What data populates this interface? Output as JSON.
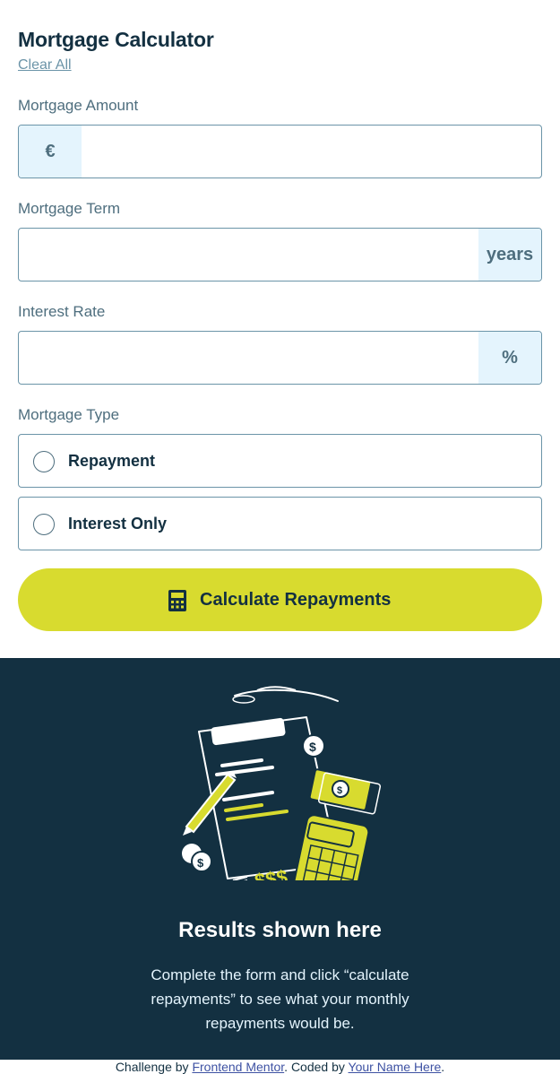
{
  "header": {
    "title": "Mortgage Calculator",
    "clear_label": "Clear All"
  },
  "amount": {
    "label": "Mortgage Amount",
    "prefix": "€",
    "value": ""
  },
  "term": {
    "label": "Mortgage Term",
    "suffix": "years",
    "value": ""
  },
  "rate": {
    "label": "Interest Rate",
    "suffix": "%",
    "value": ""
  },
  "mortgage_type": {
    "label": "Mortgage Type",
    "options": [
      {
        "label": "Repayment",
        "selected": false
      },
      {
        "label": "Interest Only",
        "selected": false
      }
    ]
  },
  "calculate_button": {
    "label": "Calculate Repayments",
    "icon": "calculator-icon"
  },
  "results": {
    "illustration": "empty-results-illustration",
    "title": "Results shown here",
    "description": "Complete the form and click “calculate repayments” to see what your monthly repayments would be."
  },
  "footer": {
    "prefix": "Challenge by ",
    "link1": "Frontend Mentor",
    "middle": ". Coded by ",
    "link2": "Your Name Here",
    "suffix": "."
  },
  "colors": {
    "lime": "#d8db2f",
    "navy": "#133041",
    "slate": "#6b94a8",
    "light_blue": "#e4f4fd"
  }
}
